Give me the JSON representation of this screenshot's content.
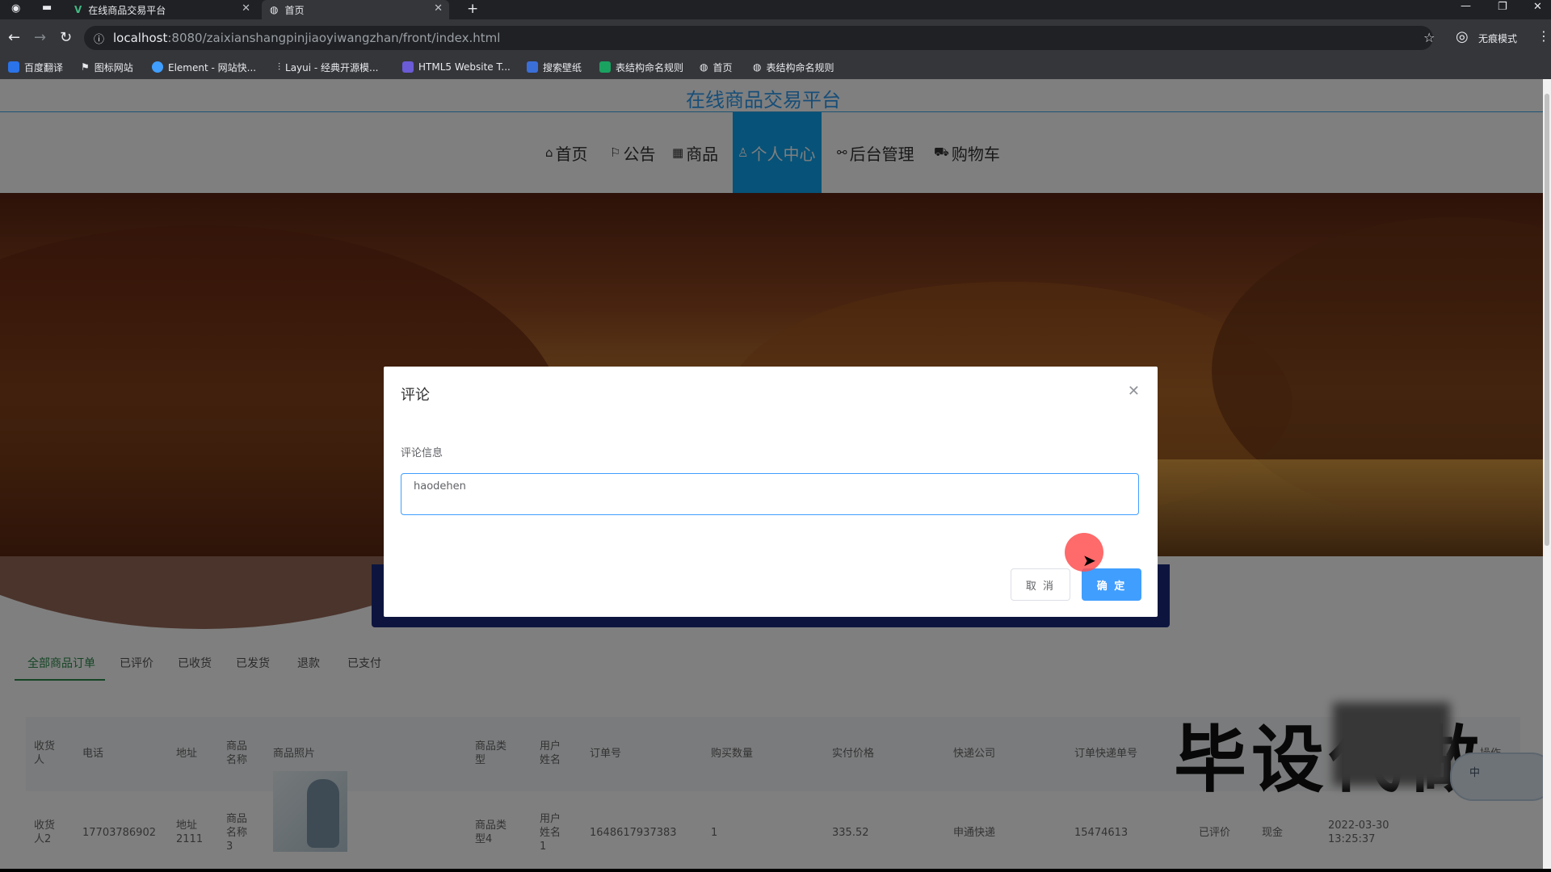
{
  "browser": {
    "tabs": [
      {
        "title": "在线商品交易平台"
      },
      {
        "title": "首页"
      }
    ],
    "url_host": "localhost",
    "url_rest": ":8080/zaixianshangpinjiaoyiwangzhan/front/index.html",
    "profile_label": "无痕模式",
    "bookmarks": [
      "百度翻译",
      "图标网站",
      "Element - 网站快...",
      "Layui - 经典开源模...",
      "HTML5 Website T...",
      "搜索壁纸",
      "表结构命名规则",
      "首页",
      "表结构命名规则"
    ]
  },
  "site": {
    "title": "在线商品交易平台",
    "menu": [
      "首页",
      "公告",
      "商品",
      "个人中心",
      "后台管理",
      "购物车"
    ],
    "active_menu": "个人中心",
    "accent_color": "#0fa5f0"
  },
  "order_tabs": [
    "全部商品订单",
    "已评价",
    "已收货",
    "已发货",
    "退款",
    "已支付"
  ],
  "table": {
    "headers": [
      "收货人",
      "电话",
      "地址",
      "商品名称",
      "商品照片",
      "商品类型",
      "用户姓名",
      "订单号",
      "购买数量",
      "实付价格",
      "快递公司",
      "订单快递单号",
      "操作"
    ],
    "row": {
      "receiver": "收货人2",
      "phone": "17703786902",
      "address": "地址2111",
      "product_name": "商品名称3",
      "product_type": "商品类型4",
      "user_name": "用户姓名1",
      "order_no": "1648617937383",
      "quantity": "1",
      "paid_price": "335.52",
      "courier": "申通快递",
      "tracking_no": "15474613",
      "status": "已评价",
      "payment": "现金",
      "time": "2022-03-30 13:25:37"
    }
  },
  "overlay_text": "毕设代做",
  "ime_label": "中",
  "dialog": {
    "title": "评论",
    "field_label": "评论信息",
    "field_value": "haodehen",
    "cancel_label": "取 消",
    "ok_label": "确 定"
  }
}
